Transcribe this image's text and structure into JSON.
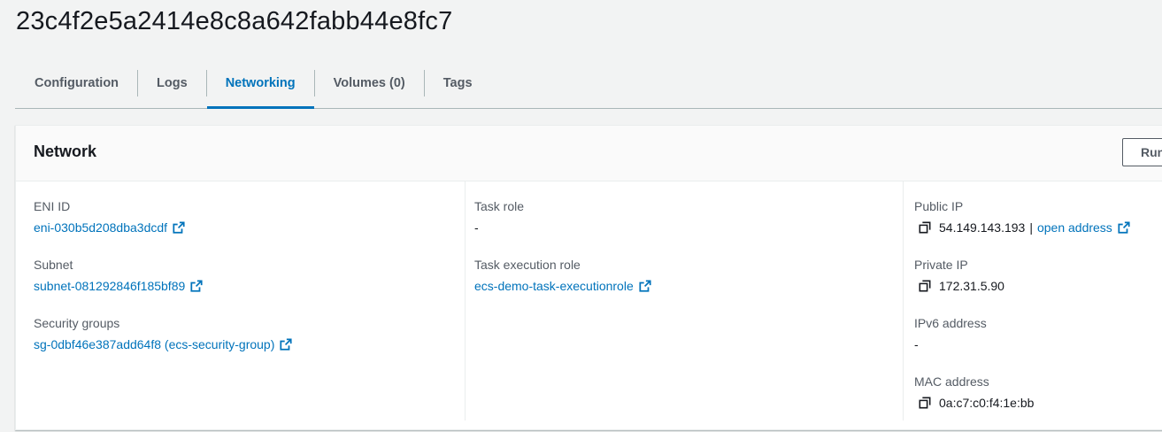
{
  "page": {
    "title": "23c4f2e5a2414e8c8a642fabb44e8fc7"
  },
  "tabs": [
    {
      "label": "Configuration",
      "active": false
    },
    {
      "label": "Logs",
      "active": false
    },
    {
      "label": "Networking",
      "active": true
    },
    {
      "label": "Volumes (0)",
      "active": false
    },
    {
      "label": "Tags",
      "active": false
    }
  ],
  "network": {
    "title": "Network",
    "header_button_label": "Run",
    "eni_id": {
      "label": "ENI ID",
      "value": "eni-030b5d208dba3dcdf"
    },
    "subnet": {
      "label": "Subnet",
      "value": "subnet-081292846f185bf89"
    },
    "security_groups": {
      "label": "Security groups",
      "value": "sg-0dbf46e387add64f8 (ecs-security-group)"
    },
    "task_role": {
      "label": "Task role",
      "value": "-"
    },
    "task_execution_role": {
      "label": "Task execution role",
      "value": "ecs-demo-task-executionrole"
    },
    "public_ip": {
      "label": "Public IP",
      "value": "54.149.143.193",
      "separator": "|",
      "link_label": "open address"
    },
    "private_ip": {
      "label": "Private IP",
      "value": "172.31.5.90"
    },
    "ipv6_address": {
      "label": "IPv6 address",
      "value": "-"
    },
    "mac_address": {
      "label": "MAC address",
      "value": "0a:c7:c0:f4:1e:bb"
    }
  },
  "colors": {
    "link": "#0073bb",
    "label": "#545b64",
    "text": "#16191f",
    "background": "#f2f3f3"
  },
  "icons": {
    "external": "external-link-icon",
    "copy": "copy-icon"
  }
}
